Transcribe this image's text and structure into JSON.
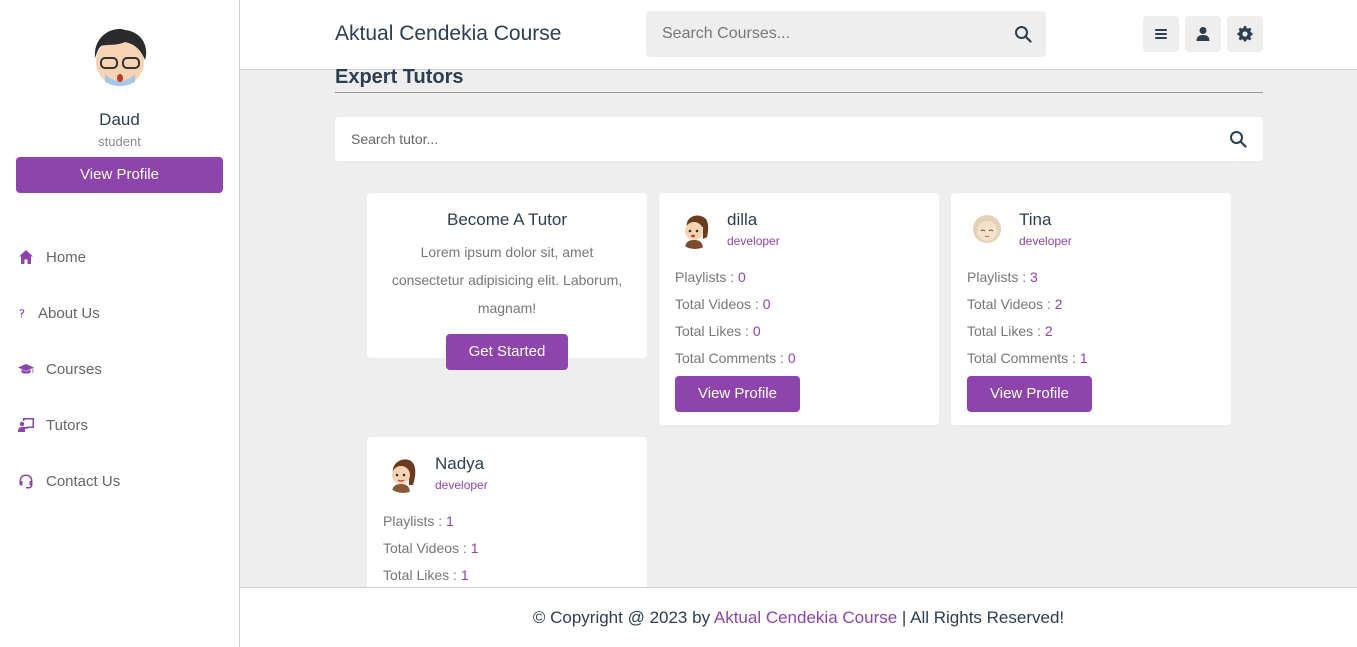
{
  "sidebar": {
    "user_name": "Daud",
    "user_role": "student",
    "view_profile_label": "View Profile",
    "nav": [
      {
        "label": "Home",
        "icon": "home-icon"
      },
      {
        "label": "About Us",
        "icon": "question-icon"
      },
      {
        "label": "Courses",
        "icon": "graduation-cap-icon"
      },
      {
        "label": "Tutors",
        "icon": "chalkboard-teacher-icon"
      },
      {
        "label": "Contact Us",
        "icon": "headset-icon"
      }
    ]
  },
  "header": {
    "logo": "Aktual Cendekia Course",
    "search_placeholder": "Search Courses...",
    "icons": [
      "menu-icon",
      "user-icon",
      "settings-icon"
    ]
  },
  "main": {
    "heading": "Expert Tutors",
    "search_placeholder": "Search tutor...",
    "become": {
      "title": "Become A Tutor",
      "text": "Lorem ipsum dolor sit, amet consectetur adipisicing elit. Laborum, magnam!",
      "button": "Get Started"
    },
    "labels": {
      "playlists": "Playlists : ",
      "videos": "Total Videos : ",
      "likes": "Total Likes : ",
      "comments": "Total Comments : ",
      "view_profile": "View Profile"
    },
    "tutors": [
      {
        "name": "dilla",
        "role": "developer",
        "playlists": "0",
        "videos": "0",
        "likes": "0",
        "comments": "0"
      },
      {
        "name": "Tina",
        "role": "developer",
        "playlists": "3",
        "videos": "2",
        "likes": "2",
        "comments": "1"
      },
      {
        "name": "Nadya",
        "role": "developer",
        "playlists": "1",
        "videos": "1",
        "likes": "1",
        "comments": ""
      }
    ]
  },
  "footer": {
    "prefix": "© Copyright @ 2023 by ",
    "brand": "Aktual Cendekia Course",
    "suffix": " | All Rights Reserved!"
  },
  "colors": {
    "accent": "#8e44ad",
    "text": "#2c3e50",
    "background": "#eeeeee"
  }
}
